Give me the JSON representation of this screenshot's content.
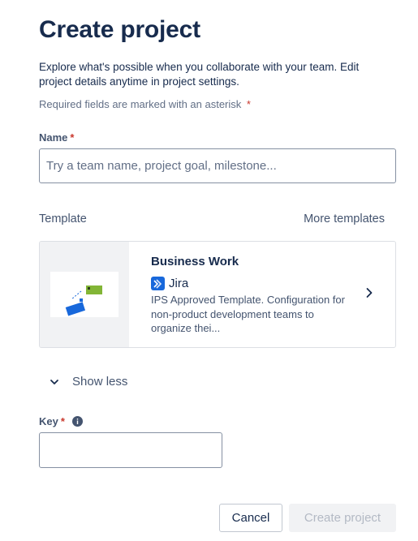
{
  "header": {
    "title": "Create project",
    "intro": "Explore what's possible when you collaborate with your team. Edit project details anytime in project settings.",
    "required_note": "Required fields are marked with an asterisk",
    "asterisk": "*"
  },
  "name_field": {
    "label": "Name",
    "placeholder": "Try a team name, project goal, milestone...",
    "value": ""
  },
  "template_section": {
    "label": "Template",
    "more_templates": "More templates",
    "card": {
      "title": "Business Work",
      "product": "Jira",
      "product_icon": "jira-logo-icon",
      "description": "IPS Approved Template. Configuration for non-product development teams to organize thei..."
    }
  },
  "toggle": {
    "label": "Show less",
    "icon": "chevron-down-icon"
  },
  "key_field": {
    "label": "Key",
    "value": "",
    "info_icon": "info-icon"
  },
  "footer": {
    "cancel_label": "Cancel",
    "create_label": "Create project"
  },
  "colors": {
    "required_asterisk": "#c9372c",
    "jira_brand": "#1868db",
    "thumbnail_green": "#82b536",
    "thumbnail_blue": "#1868db"
  }
}
